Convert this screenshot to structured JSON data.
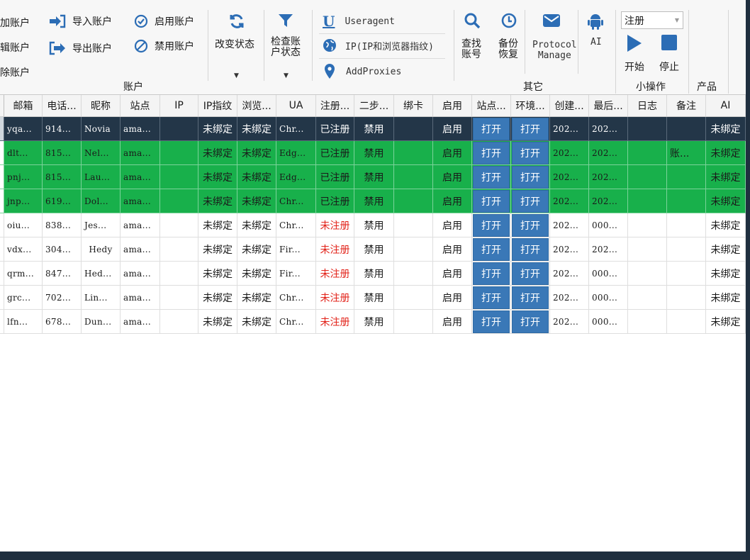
{
  "ribbon": {
    "account_group": {
      "add": "加账户",
      "edit": "辑账户",
      "delete": "除账户",
      "import": "导入账户",
      "export": "导出账户",
      "enable": "启用账户",
      "disable": "禁用账户",
      "label": "账户"
    },
    "change_status": "改变状态",
    "check_status": "检查账户状态",
    "check_status_line1": "检查账",
    "check_status_line2": "户状态",
    "useragent": "Useragent",
    "ip_fingerprint": "IP(IP和浏览器指纹)",
    "addproxies": "AddProxies",
    "find_account_1": "查找",
    "find_account_2": "账号",
    "backup_1": "备份",
    "backup_2": "恢复",
    "protocol_1": "Protocol",
    "protocol_2": "Manage",
    "ai": "AI",
    "other_label": "其它",
    "mode_select": "注册",
    "start": "开始",
    "stop": "停止",
    "small_ops_label": "小操作",
    "product_label": "产品",
    "colors": {
      "blue_icon": "#2c6db5",
      "selected_row": "#233648",
      "green_row": "#18b04b",
      "open_button": "#3a78b7"
    }
  },
  "grid": {
    "headers": [
      "邮箱",
      "电话...",
      "昵称",
      "站点",
      "IP",
      "IP指纹",
      "浏览...",
      "UA",
      "注册...",
      "二步...",
      "绑卡",
      "启用",
      "站点...",
      "环境...",
      "创建...",
      "最后...",
      "日志",
      "备注",
      "AI"
    ],
    "open_label": "打开",
    "rows": [
      {
        "email": "yqa...",
        "phone": "914...",
        "nick": "Novia",
        "site": "ama...",
        "ip": "",
        "ipfp": "未绑定",
        "browser": "未绑定",
        "ua": "Chr...",
        "reg": "已注册",
        "twostep": "禁用",
        "card": "",
        "enabled": "启用",
        "created": "202...",
        "last": "202...",
        "log": "",
        "note": "",
        "ai": "未绑定"
      },
      {
        "email": "dlt...",
        "phone": "815...",
        "nick": "Nel...",
        "site": "ama...",
        "ip": "",
        "ipfp": "未绑定",
        "browser": "未绑定",
        "ua": "Edg...",
        "reg": "已注册",
        "twostep": "禁用",
        "card": "",
        "enabled": "启用",
        "created": "202...",
        "last": "202...",
        "log": "",
        "note": "账...",
        "ai": "未绑定"
      },
      {
        "email": "pnj...",
        "phone": "815...",
        "nick": "Lau...",
        "site": "ama...",
        "ip": "",
        "ipfp": "未绑定",
        "browser": "未绑定",
        "ua": "Edg...",
        "reg": "已注册",
        "twostep": "禁用",
        "card": "",
        "enabled": "启用",
        "created": "202...",
        "last": "202...",
        "log": "",
        "note": "",
        "ai": "未绑定"
      },
      {
        "email": "jnp...",
        "phone": "619...",
        "nick": "Dol...",
        "site": "ama...",
        "ip": "",
        "ipfp": "未绑定",
        "browser": "未绑定",
        "ua": "Chr...",
        "reg": "已注册",
        "twostep": "禁用",
        "card": "",
        "enabled": "启用",
        "created": "202...",
        "last": "202...",
        "log": "",
        "note": "",
        "ai": "未绑定"
      },
      {
        "email": "oiu...",
        "phone": "838...",
        "nick": "Jes...",
        "site": "ama...",
        "ip": "",
        "ipfp": "未绑定",
        "browser": "未绑定",
        "ua": "Chr...",
        "reg": "未注册",
        "twostep": "禁用",
        "card": "",
        "enabled": "启用",
        "created": "202...",
        "last": "000...",
        "log": "",
        "note": "",
        "ai": "未绑定"
      },
      {
        "email": "vdx...",
        "phone": "304...",
        "nick": "Hedy",
        "site": "ama...",
        "ip": "",
        "ipfp": "未绑定",
        "browser": "未绑定",
        "ua": "Fir...",
        "reg": "未注册",
        "twostep": "禁用",
        "card": "",
        "enabled": "启用",
        "created": "202...",
        "last": "202...",
        "log": "",
        "note": "",
        "ai": "未绑定"
      },
      {
        "email": "qrm...",
        "phone": "847...",
        "nick": "Hed...",
        "site": "ama...",
        "ip": "",
        "ipfp": "未绑定",
        "browser": "未绑定",
        "ua": "Fir...",
        "reg": "未注册",
        "twostep": "禁用",
        "card": "",
        "enabled": "启用",
        "created": "202...",
        "last": "000...",
        "log": "",
        "note": "",
        "ai": "未绑定"
      },
      {
        "email": "grc...",
        "phone": "702...",
        "nick": "Lin...",
        "site": "ama...",
        "ip": "",
        "ipfp": "未绑定",
        "browser": "未绑定",
        "ua": "Chr...",
        "reg": "未注册",
        "twostep": "禁用",
        "card": "",
        "enabled": "启用",
        "created": "202...",
        "last": "000...",
        "log": "",
        "note": "",
        "ai": "未绑定"
      },
      {
        "email": "lfn...",
        "phone": "678...",
        "nick": "Dun...",
        "site": "ama...",
        "ip": "",
        "ipfp": "未绑定",
        "browser": "未绑定",
        "ua": "Chr...",
        "reg": "未注册",
        "twostep": "禁用",
        "card": "",
        "enabled": "启用",
        "created": "202...",
        "last": "000...",
        "log": "",
        "note": "",
        "ai": "未绑定"
      }
    ]
  }
}
